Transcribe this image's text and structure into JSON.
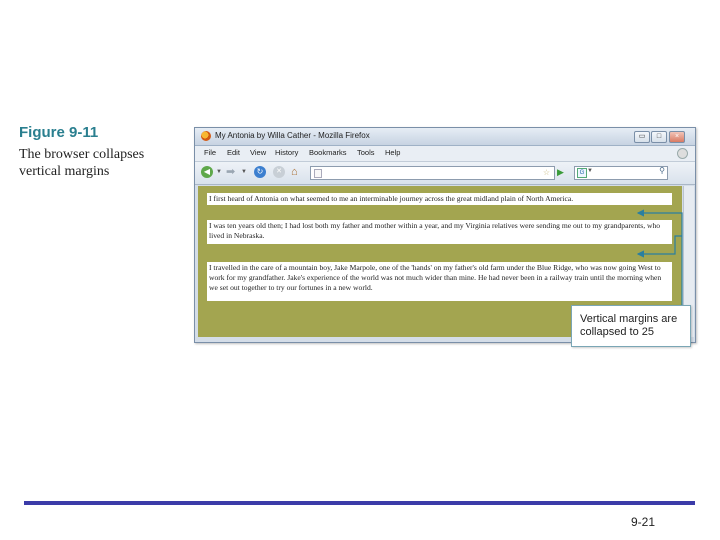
{
  "figure": {
    "label": "Figure 9-11",
    "caption": "The browser collapses vertical margins"
  },
  "browser": {
    "title": "My Antonia by Willa Cather - Mozilla Firefox",
    "window_controls": {
      "minimize": "▭",
      "maximize": "□",
      "close": "×"
    },
    "menu": [
      "File",
      "Edit",
      "View",
      "History",
      "Bookmarks",
      "Tools",
      "Help"
    ],
    "icons": {
      "back": "back-arrow-icon",
      "forward": "forward-arrow-icon",
      "reload": "reload-icon",
      "stop": "stop-icon",
      "home": "home-icon",
      "go": "go-arrow-icon",
      "search_engine": "google-icon",
      "search": "magnifier-icon"
    },
    "address_value": "",
    "search_value": ""
  },
  "page": {
    "background": "#a3a550",
    "paragraphs": [
      "I first heard of Antonia on what seemed to me an interminable journey across the great midland plain of North America.",
      "I was ten years old then; I had lost both my father and mother within a year, and my Virginia relatives were sending me out to my grandparents, who lived in Nebraska.",
      "I travelled in the care of a mountain boy, Jake Marpole, one of the 'hands' on my father's old farm under the Blue Ridge, who was now going West to work for my grandfather. Jake's experience of the world was not much wider than mine. He had never been in a railway train until the morning when we set out together to try our fortunes in a new world."
    ]
  },
  "callout": {
    "text": "Vertical margins are collapsed to 25"
  },
  "footer": {
    "page_number": "9-21",
    "rule_color": "#3b3ba8"
  }
}
